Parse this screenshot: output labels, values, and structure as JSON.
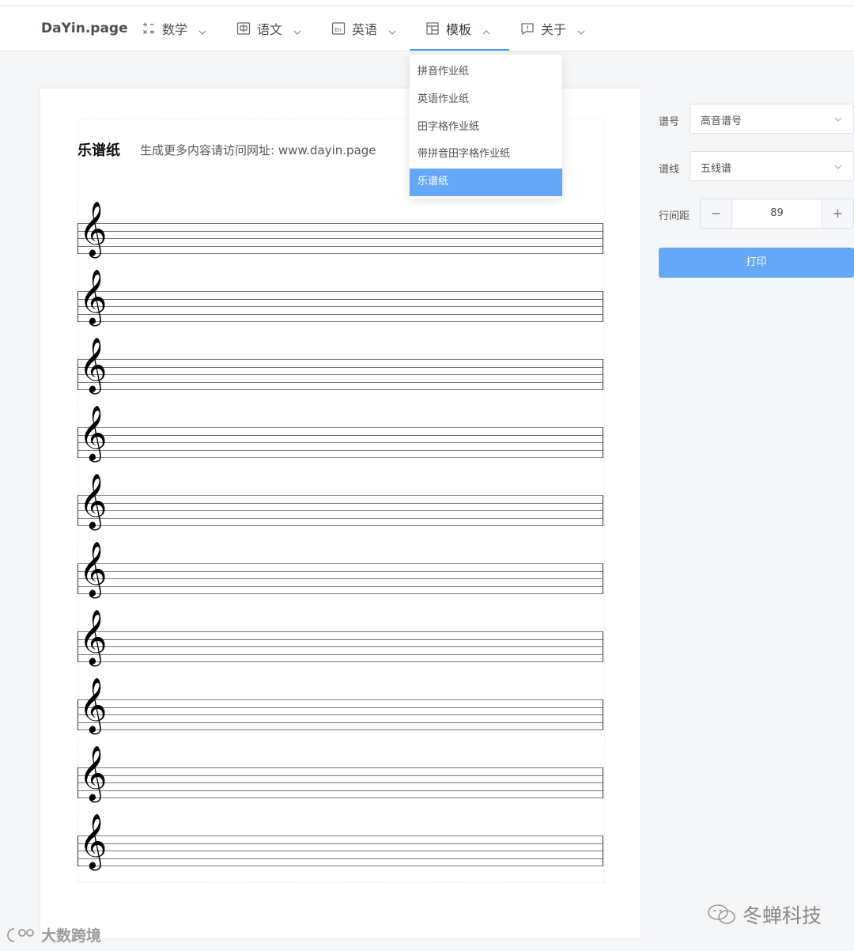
{
  "brand": "DaYin.page",
  "nav": [
    {
      "label": "数学",
      "icon": "math-operators-icon"
    },
    {
      "label": "语文",
      "icon": "chinese-char-icon"
    },
    {
      "label": "英语",
      "icon": "english-en-icon"
    },
    {
      "label": "模板",
      "icon": "template-icon",
      "active": true
    },
    {
      "label": "关于",
      "icon": "info-comment-icon"
    }
  ],
  "dropdown": {
    "items": [
      "拼音作业纸",
      "英语作业纸",
      "田字格作业纸",
      "带拼音田字格作业纸",
      "乐谱纸"
    ],
    "selected": "乐谱纸"
  },
  "sheet": {
    "title": "乐谱纸",
    "subtitle": "生成更多内容请访问网址:  www.dayin.page",
    "staff_count": 10,
    "clef_glyph": "𝄞"
  },
  "settings": {
    "clef_label": "谱号",
    "clef_value": "高音谱号",
    "lines_label": "谱线",
    "lines_value": "五线谱",
    "spacing_label": "行间距",
    "spacing_value": "89",
    "minus": "−",
    "plus": "+",
    "print_label": "打印"
  },
  "watermarks": {
    "right": "冬蝉科技",
    "left": "大数跨境"
  },
  "colors": {
    "accent": "#409eff",
    "button": "#66a8f8"
  }
}
